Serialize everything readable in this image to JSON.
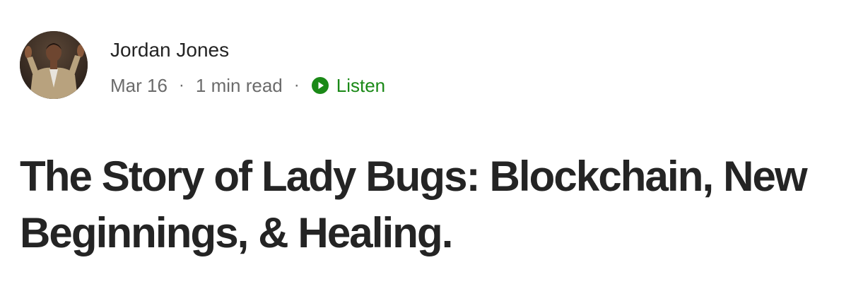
{
  "author": {
    "name": "Jordan Jones",
    "avatar_icon": "author-photo"
  },
  "meta": {
    "date": "Mar 16",
    "separator": "·",
    "read_time": "1 min read",
    "listen_label": "Listen",
    "listen_icon": "play-circle-icon",
    "listen_color": "#1a8917"
  },
  "article": {
    "title": "The Story of Lady Bugs: Blockchain, New Beginnings, & Healing."
  }
}
